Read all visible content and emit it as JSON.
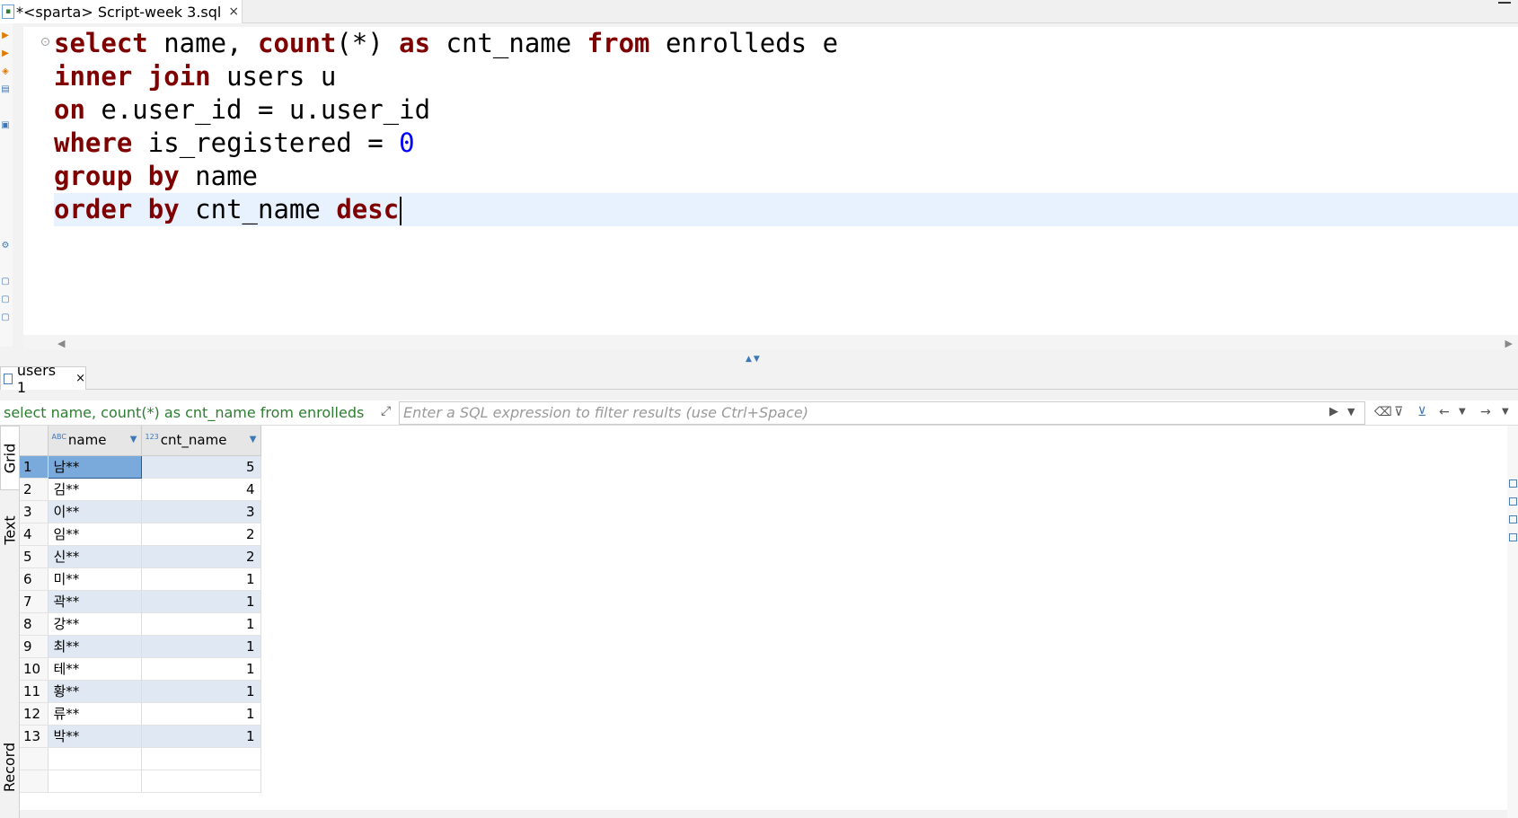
{
  "editor_tab": {
    "title": "*<sparta> Script-week 3.sql",
    "close": "×"
  },
  "code": {
    "line1": {
      "kw1": "select",
      "t1": " name, ",
      "kw2": "count",
      "t2": "(*) ",
      "kw3": "as",
      "t3": " cnt_name ",
      "kw4": "from",
      "t4": " enrolleds e"
    },
    "line2": {
      "kw1": "inner",
      "t1": " ",
      "kw2": "join",
      "t2": " users u"
    },
    "line3": {
      "kw1": "on",
      "t1": " e.user_id = u.user_id"
    },
    "line4": {
      "kw1": "where",
      "t1": " is_registered = ",
      "num": "0"
    },
    "line5": {
      "kw1": "group",
      "t1": " ",
      "kw2": "by",
      "t2": " name"
    },
    "line6": {
      "kw1": "order",
      "t1": " ",
      "kw2": "by",
      "t2": " cnt_name ",
      "kw3": "desc"
    }
  },
  "results": {
    "tab_label": "users 1",
    "tab_close": "×",
    "query_label": "select name, count(*) as cnt_name from enrolleds",
    "filter_placeholder": "Enter a SQL expression to filter results (use Ctrl+Space)",
    "side_tabs": [
      "Grid",
      "Text",
      "Record"
    ],
    "columns": [
      {
        "type": "ABC",
        "label": "name"
      },
      {
        "type": "123",
        "label": "cnt_name"
      }
    ],
    "rows": [
      {
        "n": "1",
        "name": "남**",
        "cnt": "5"
      },
      {
        "n": "2",
        "name": "김**",
        "cnt": "4"
      },
      {
        "n": "3",
        "name": "이**",
        "cnt": "3"
      },
      {
        "n": "4",
        "name": "임**",
        "cnt": "2"
      },
      {
        "n": "5",
        "name": "신**",
        "cnt": "2"
      },
      {
        "n": "6",
        "name": "미**",
        "cnt": "1"
      },
      {
        "n": "7",
        "name": "곽**",
        "cnt": "1"
      },
      {
        "n": "8",
        "name": "강**",
        "cnt": "1"
      },
      {
        "n": "9",
        "name": "최**",
        "cnt": "1"
      },
      {
        "n": "10",
        "name": "테**",
        "cnt": "1"
      },
      {
        "n": "11",
        "name": "황**",
        "cnt": "1"
      },
      {
        "n": "12",
        "name": "류**",
        "cnt": "1"
      },
      {
        "n": "13",
        "name": "박**",
        "cnt": "1"
      }
    ]
  }
}
